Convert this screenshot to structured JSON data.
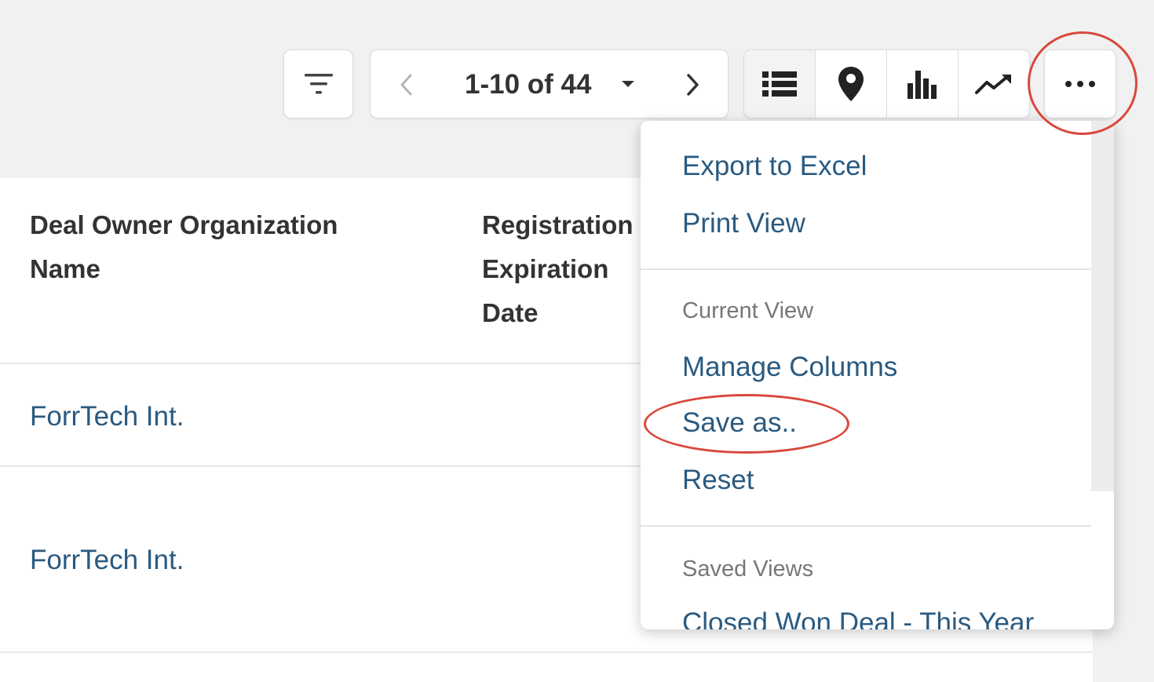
{
  "toolbar": {
    "filter_icon": "filter-lines-icon",
    "pagination": {
      "label": "1-10 of 44",
      "prev_icon": "chevron-left-icon",
      "dropdown_icon": "caret-down-icon",
      "next_icon": "chevron-right-icon"
    },
    "view_buttons": [
      {
        "icon": "list-view-icon",
        "active": true
      },
      {
        "icon": "map-pin-icon",
        "active": false
      },
      {
        "icon": "bar-chart-icon",
        "active": false
      },
      {
        "icon": "trend-line-icon",
        "active": false
      }
    ],
    "more_icon": "more-horizontal-icon"
  },
  "table": {
    "headers": [
      "Deal Owner Organization Name",
      "Registration Expiration Date"
    ],
    "rows": [
      {
        "owner": "ForrTech Int."
      },
      {
        "owner": "ForrTech Int."
      }
    ]
  },
  "menu": {
    "items": {
      "export": "Export to Excel",
      "print": "Print View",
      "current_view_header": "Current View",
      "manage_columns": "Manage Columns",
      "save_as": "Save as..",
      "reset": "Reset",
      "saved_views_header": "Saved Views",
      "saved_view_1": "Closed Won Deal - This Year"
    }
  },
  "colors": {
    "link": "#2a5a80",
    "annotation": "#d9483b",
    "background": "#f1f1f1"
  }
}
